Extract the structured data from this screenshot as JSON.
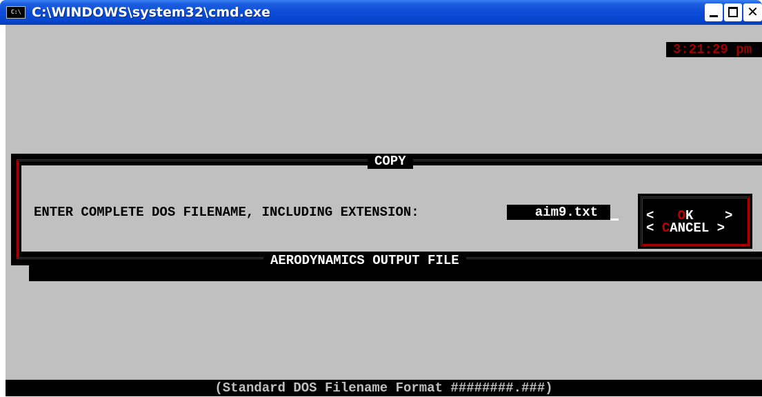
{
  "window": {
    "title": "C:\\WINDOWS\\system32\\cmd.exe",
    "icon": "cmd-icon",
    "icon_text": "C:\\"
  },
  "clock": "3:21:29 pm",
  "dialog": {
    "title": "COPY",
    "prompt": "ENTER COMPLETE DOS FILENAME, INCLUDING EXTENSION:",
    "filename": "aim9.txt",
    "ok_button": {
      "left": "<",
      "hotkey": "O",
      "rest": "K",
      "right": ">"
    },
    "cancel_button": {
      "left": "<",
      "hotkey": "C",
      "rest": "ANCEL",
      "right": ">"
    }
  },
  "section_title": "AERODYNAMICS OUTPUT FILE",
  "status_text": "(Standard DOS Filename Format ########.###)",
  "colors": {
    "console_bg": "#c0c0c0",
    "frame_red": "#c00000",
    "titlebar_blue": "#0b4bd6"
  }
}
